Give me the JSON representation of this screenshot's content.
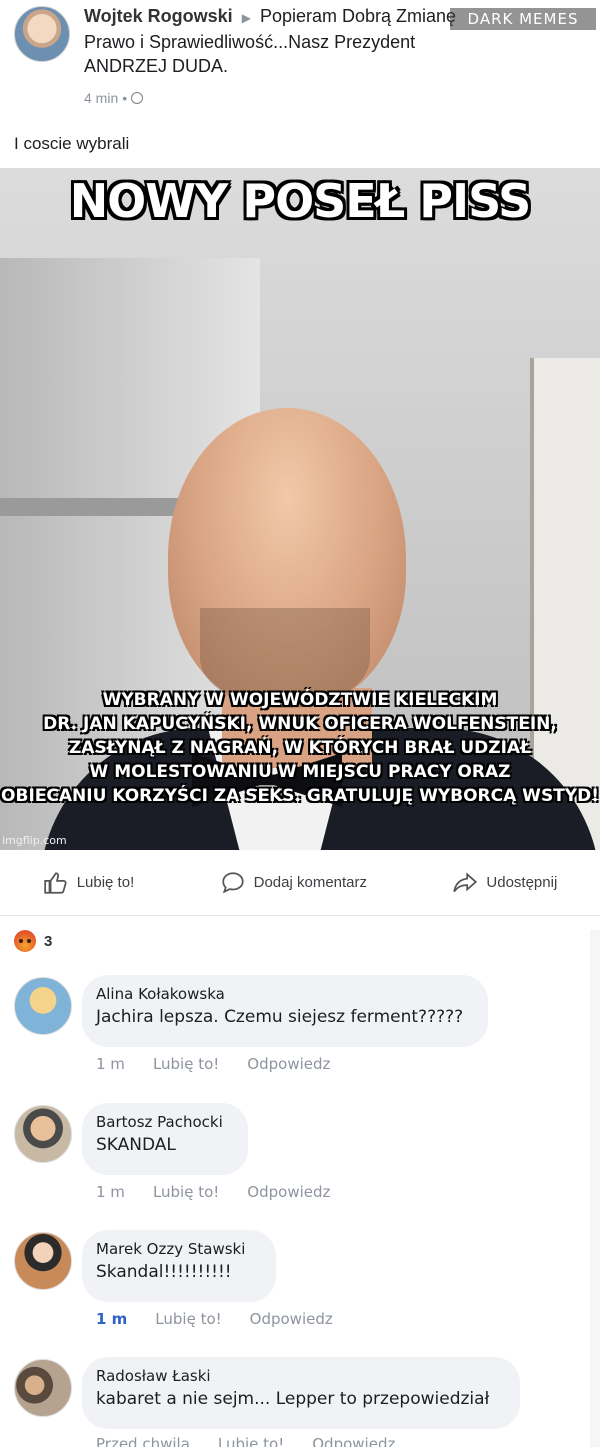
{
  "post": {
    "author": "Wojtek Rogowski",
    "arrow": "▶",
    "target_line1": "Popieram Dobrą Zmianę",
    "line2": "Prawo i Sprawiedliwość...Nasz Prezydent",
    "line3": "ANDRZEJ DUDA.",
    "time": "4 min",
    "dot": "•",
    "text": "I coscie wybrali"
  },
  "watermark": "DARK MEMES",
  "meme": {
    "title": "NOWY POSEŁ PISS",
    "caption_lines": [
      "WYBRANY W WOJEWÓDZTWIE KIELECKIM",
      "DR. JAN KAPUCYŃSKI, WNUK OFICERA WOLFENSTEIN,",
      "ZASŁYNĄŁ Z NAGRAŃ, W KTÓRYCH BRAŁ UDZIAŁ",
      "W MOLESTOWANIU W MIEJSCU PRACY ORAZ",
      "OBIECANIU KORZYŚCI ZA SEKS. GRATULUJĘ WYBORCĄ WSTYD!"
    ],
    "source": "imgflip.com"
  },
  "actions": {
    "like": "Lubię to!",
    "comment": "Dodaj komentarz",
    "share": "Udostępnij"
  },
  "reactions": {
    "count": "3"
  },
  "comments": [
    {
      "name": "Alina Kołakowska",
      "text": "Jachira lepsza. Czemu siejesz ferment?????",
      "time": "1 m",
      "like": "Lubię to!",
      "reply": "Odpowiedz"
    },
    {
      "name": "Bartosz Pachocki",
      "text": "SKANDAL",
      "time": "1 m",
      "like": "Lubię to!",
      "reply": "Odpowiedz"
    },
    {
      "name": "Marek Ozzy Stawski",
      "text": "Skandal!!!!!!!!!!",
      "time": "1 m",
      "like": "Lubię to!",
      "reply": "Odpowiedz"
    },
    {
      "name": "Radosław Łaski",
      "text": "kabaret a nie sejm... Lepper to przepowiedział",
      "time": "Przed chwilą",
      "like": "Lubię to!",
      "reply": "Odpowiedz"
    }
  ],
  "colors": {
    "bubble": "#f0f2f5",
    "meta": "#8d949e",
    "new_time": "#2d63c6"
  }
}
